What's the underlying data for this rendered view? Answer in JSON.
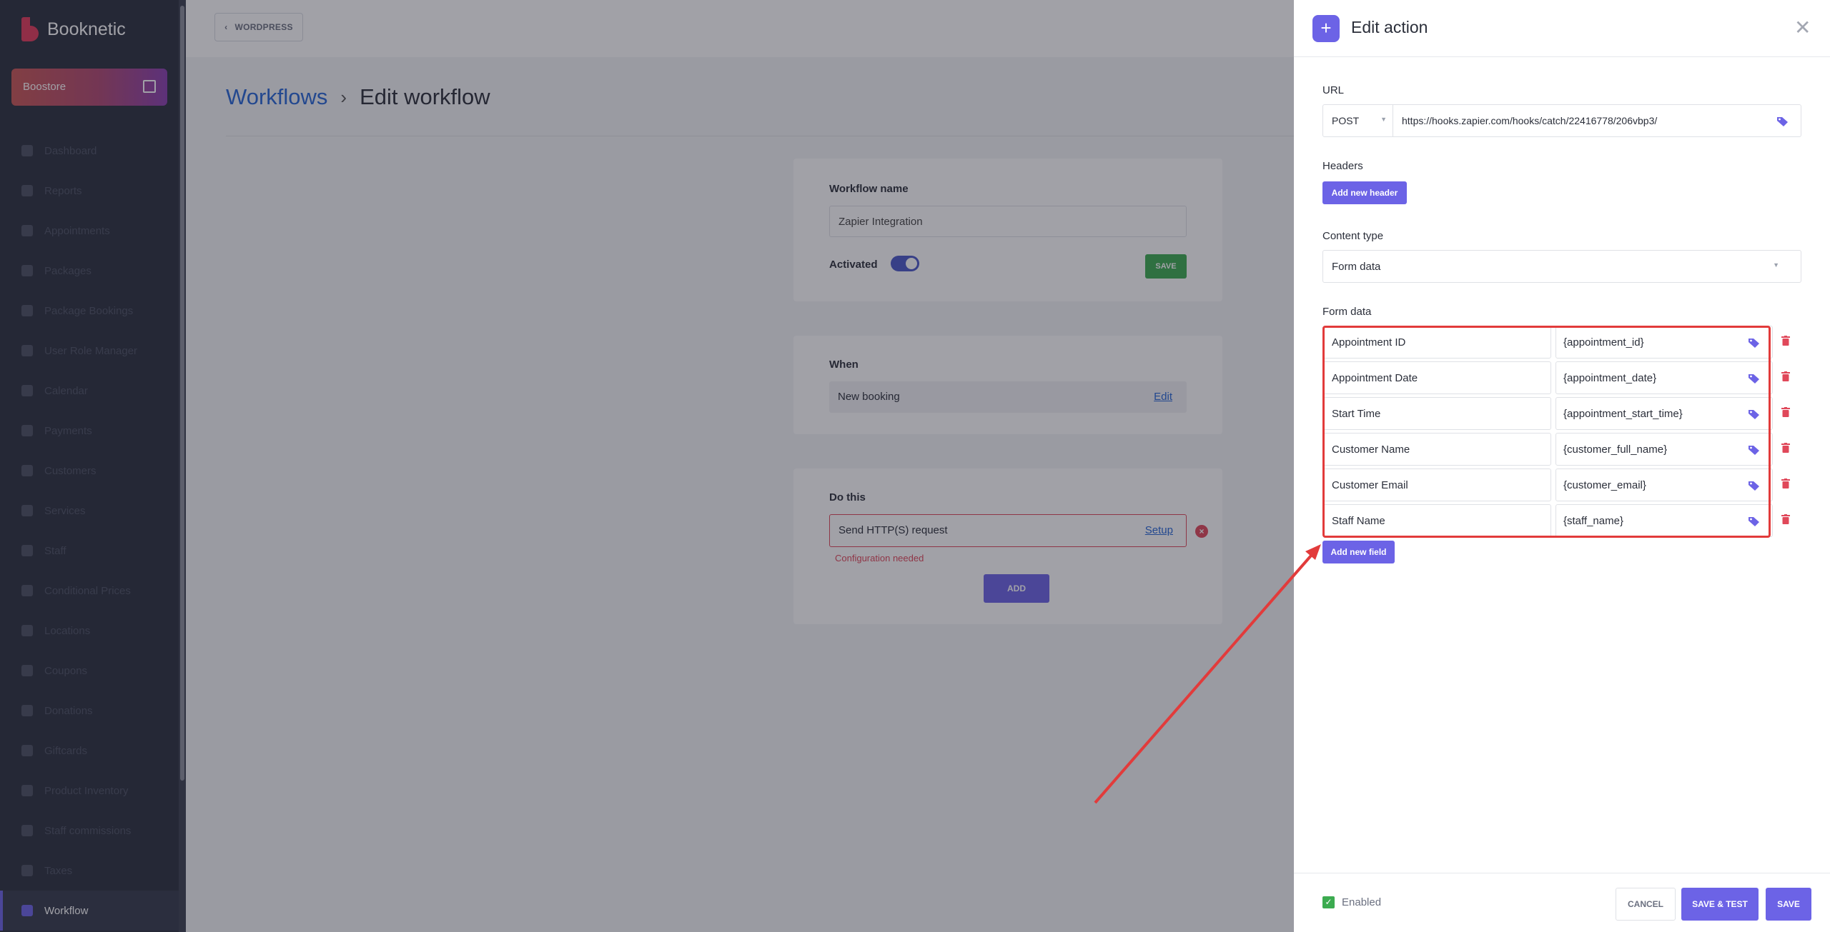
{
  "sidebar": {
    "logo": "Booknetic",
    "store": "Boostore",
    "items": [
      {
        "label": "Dashboard",
        "icon": "dashboard-icon"
      },
      {
        "label": "Reports",
        "icon": "chart-icon"
      },
      {
        "label": "Appointments",
        "icon": "clock-icon"
      },
      {
        "label": "Packages",
        "icon": "package-icon"
      },
      {
        "label": "Package Bookings",
        "icon": "package-booking-icon"
      },
      {
        "label": "User Role Manager",
        "icon": "user-role-icon"
      },
      {
        "label": "Calendar",
        "icon": "calendar-icon"
      },
      {
        "label": "Payments",
        "icon": "payment-icon"
      },
      {
        "label": "Customers",
        "icon": "customers-icon"
      },
      {
        "label": "Services",
        "icon": "services-icon"
      },
      {
        "label": "Staff",
        "icon": "staff-icon"
      },
      {
        "label": "Conditional Prices",
        "icon": "price-icon"
      },
      {
        "label": "Locations",
        "icon": "location-icon"
      },
      {
        "label": "Coupons",
        "icon": "coupon-icon"
      },
      {
        "label": "Donations",
        "icon": "donation-icon"
      },
      {
        "label": "Giftcards",
        "icon": "giftcard-icon"
      },
      {
        "label": "Product Inventory",
        "icon": "inventory-icon"
      },
      {
        "label": "Staff commissions",
        "icon": "commission-icon"
      },
      {
        "label": "Taxes",
        "icon": "tax-icon"
      },
      {
        "label": "Workflow",
        "icon": "workflow-icon",
        "active": true
      }
    ]
  },
  "topbar": {
    "wordpress_label": "WORDPRESS"
  },
  "breadcrumb": {
    "parent": "Workflows",
    "separator": "›",
    "current": "Edit workflow"
  },
  "workflow_card": {
    "name_label": "Workflow name",
    "name_value": "Zapier Integration",
    "activated_label": "Activated",
    "activated": true,
    "save_label": "SAVE"
  },
  "when_card": {
    "title": "When",
    "trigger": "New booking",
    "edit_label": "Edit"
  },
  "do_card": {
    "title": "Do this",
    "action": "Send HTTP(S) request",
    "setup_label": "Setup",
    "error": "Configuration needed",
    "add_label": "ADD"
  },
  "panel": {
    "title": "Edit action",
    "url_label": "URL",
    "method": "POST",
    "url": "https://hooks.zapier.com/hooks/catch/22416778/206vbp3/",
    "headers_label": "Headers",
    "add_header_label": "Add new header",
    "content_type_label": "Content type",
    "content_type": "Form data",
    "form_data_label": "Form data",
    "form_data": [
      {
        "key": "Appointment ID",
        "value": "{appointment_id}"
      },
      {
        "key": "Appointment Date",
        "value": "{appointment_date}"
      },
      {
        "key": "Start Time",
        "value": "{appointment_start_time}"
      },
      {
        "key": "Customer Name",
        "value": "{customer_full_name}"
      },
      {
        "key": "Customer Email",
        "value": "{customer_email}"
      },
      {
        "key": "Staff Name",
        "value": "{staff_name}"
      }
    ],
    "add_field_label": "Add new field",
    "enabled_label": "Enabled",
    "enabled": true,
    "cancel_label": "CANCEL",
    "save_test_label": "SAVE & TEST",
    "save_label": "SAVE"
  },
  "colors": {
    "accent": "#6c63e6",
    "success": "#3cab50",
    "danger": "#e0485a",
    "link": "#2667d6",
    "annotation": "#e23b3b"
  }
}
